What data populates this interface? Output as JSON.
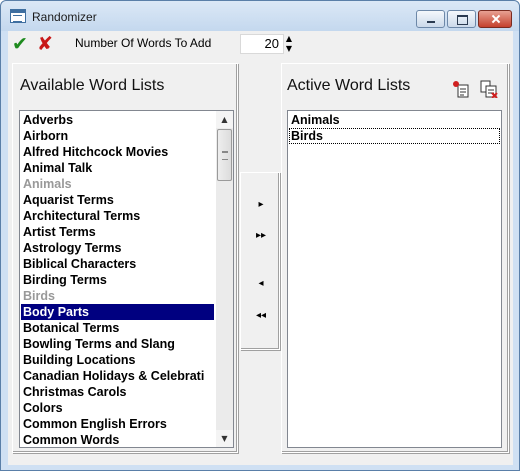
{
  "window": {
    "title": "Randomizer"
  },
  "toolbar": {
    "ok_glyph": "✔",
    "cancel_glyph": "✘",
    "words_label": "Number Of Words To Add",
    "words_value": "20",
    "spin_up_glyph": "▲",
    "spin_down_glyph": "▼"
  },
  "available": {
    "title": "Available Word Lists",
    "items": [
      {
        "label": "Adverbs"
      },
      {
        "label": "Airborn"
      },
      {
        "label": "Alfred Hitchcock Movies"
      },
      {
        "label": "Animal Talk"
      },
      {
        "label": "Animals"
      },
      {
        "label": "Aquarist Terms"
      },
      {
        "label": "Architectural Terms"
      },
      {
        "label": "Artist Terms"
      },
      {
        "label": "Astrology Terms"
      },
      {
        "label": "Biblical Characters"
      },
      {
        "label": "Birding Terms"
      },
      {
        "label": "Birds"
      },
      {
        "label": "Body Parts"
      },
      {
        "label": "Botanical Terms"
      },
      {
        "label": "Bowling Terms and Slang"
      },
      {
        "label": "Building Locations"
      },
      {
        "label": "Canadian Holidays & Celebrati"
      },
      {
        "label": "Christmas Carols"
      },
      {
        "label": "Colors"
      },
      {
        "label": "Common English Errors"
      },
      {
        "label": "Common Words"
      }
    ],
    "disabled_items": [
      "Animals",
      "Birds"
    ],
    "selected_item": "Body Parts"
  },
  "transfer": {
    "add_one": "▸",
    "add_all": "▸▸",
    "remove_one": "◂",
    "remove_all": "◂◂"
  },
  "active": {
    "title": "Active Word Lists",
    "items": [
      {
        "label": "Animals"
      },
      {
        "label": "Birds"
      }
    ]
  },
  "colors": {
    "selection": "#000080",
    "disabled_text": "#999999",
    "ok_green": "#1e8a1e",
    "cancel_red": "#c81818"
  }
}
